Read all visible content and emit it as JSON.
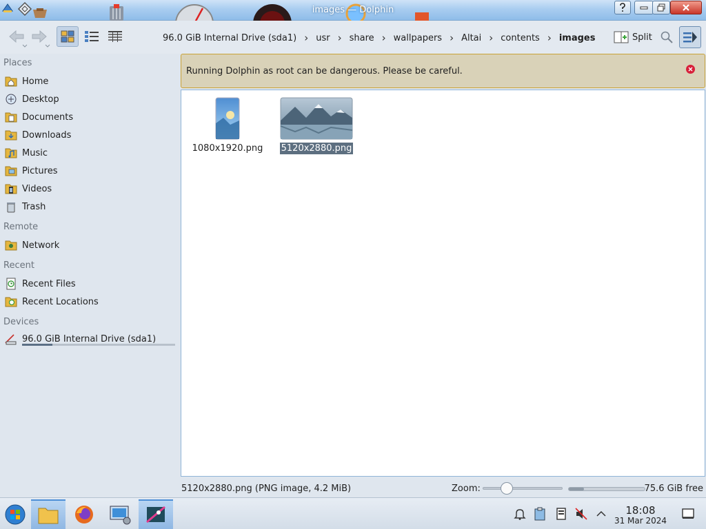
{
  "window": {
    "title": "images — Dolphin"
  },
  "toolbar": {
    "split_label": "Split"
  },
  "breadcrumb": [
    "96.0 GiB Internal Drive (sda1)",
    "usr",
    "share",
    "wallpapers",
    "Altai",
    "contents",
    "images"
  ],
  "sidebar": {
    "places_header": "Places",
    "places": [
      {
        "label": "Home",
        "icon": "home-folder-icon"
      },
      {
        "label": "Desktop",
        "icon": "desktop-icon"
      },
      {
        "label": "Documents",
        "icon": "documents-folder-icon"
      },
      {
        "label": "Downloads",
        "icon": "downloads-folder-icon"
      },
      {
        "label": "Music",
        "icon": "music-folder-icon"
      },
      {
        "label": "Pictures",
        "icon": "pictures-folder-icon"
      },
      {
        "label": "Videos",
        "icon": "videos-folder-icon"
      },
      {
        "label": "Trash",
        "icon": "trash-icon"
      }
    ],
    "remote_header": "Remote",
    "remote": [
      {
        "label": "Network",
        "icon": "network-folder-icon"
      }
    ],
    "recent_header": "Recent",
    "recent": [
      {
        "label": "Recent Files",
        "icon": "recent-files-icon"
      },
      {
        "label": "Recent Locations",
        "icon": "recent-locations-icon"
      }
    ],
    "devices_header": "Devices",
    "devices": [
      {
        "label": "96.0 GiB Internal Drive (sda1)",
        "icon": "drive-icon",
        "usage_fraction": 0.2
      }
    ]
  },
  "warning": {
    "message": "Running Dolphin as root can be dangerous. Please be careful."
  },
  "files": [
    {
      "name": "1080x1920.png",
      "selected": false
    },
    {
      "name": "5120x2880.png",
      "selected": true
    }
  ],
  "statusbar": {
    "status": "5120x2880.png (PNG image, 4.2 MiB)",
    "zoom_label": "Zoom:",
    "zoom_fraction": 0.3,
    "used_fraction": 0.2,
    "free": "75.6 GiB free"
  },
  "taskbar": {
    "time": "18:08",
    "date": "31 Mar 2024"
  },
  "colors": {
    "accent": "#4d8fd6",
    "warning_border": "#c9a236",
    "warning_bg": "#d9d2b8",
    "selection": "#5d6f80"
  }
}
